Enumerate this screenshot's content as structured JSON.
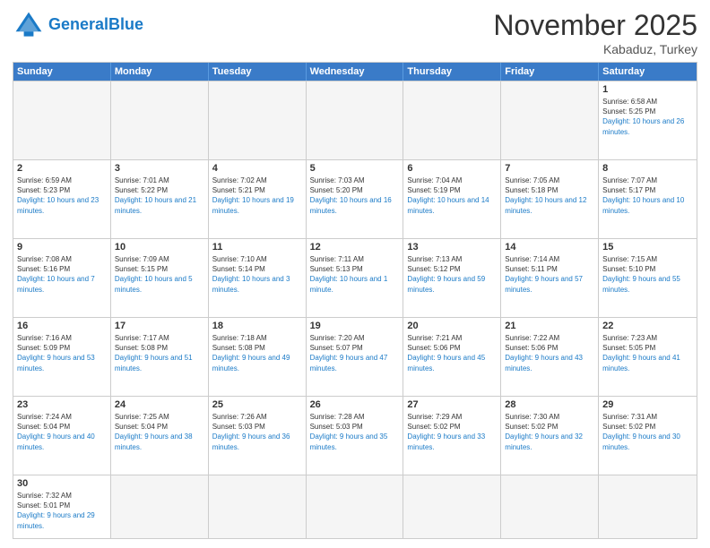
{
  "header": {
    "logo_general": "General",
    "logo_blue": "Blue",
    "month": "November 2025",
    "location": "Kabaduz, Turkey"
  },
  "days_of_week": [
    "Sunday",
    "Monday",
    "Tuesday",
    "Wednesday",
    "Thursday",
    "Friday",
    "Saturday"
  ],
  "weeks": [
    [
      {
        "day": "",
        "sunrise": "",
        "sunset": "",
        "daylight": ""
      },
      {
        "day": "",
        "sunrise": "",
        "sunset": "",
        "daylight": ""
      },
      {
        "day": "",
        "sunrise": "",
        "sunset": "",
        "daylight": ""
      },
      {
        "day": "",
        "sunrise": "",
        "sunset": "",
        "daylight": ""
      },
      {
        "day": "",
        "sunrise": "",
        "sunset": "",
        "daylight": ""
      },
      {
        "day": "",
        "sunrise": "",
        "sunset": "",
        "daylight": ""
      },
      {
        "day": "1",
        "sunrise": "Sunrise: 6:58 AM",
        "sunset": "Sunset: 5:25 PM",
        "daylight": "Daylight: 10 hours and 26 minutes."
      }
    ],
    [
      {
        "day": "2",
        "sunrise": "Sunrise: 6:59 AM",
        "sunset": "Sunset: 5:23 PM",
        "daylight": "Daylight: 10 hours and 23 minutes."
      },
      {
        "day": "3",
        "sunrise": "Sunrise: 7:01 AM",
        "sunset": "Sunset: 5:22 PM",
        "daylight": "Daylight: 10 hours and 21 minutes."
      },
      {
        "day": "4",
        "sunrise": "Sunrise: 7:02 AM",
        "sunset": "Sunset: 5:21 PM",
        "daylight": "Daylight: 10 hours and 19 minutes."
      },
      {
        "day": "5",
        "sunrise": "Sunrise: 7:03 AM",
        "sunset": "Sunset: 5:20 PM",
        "daylight": "Daylight: 10 hours and 16 minutes."
      },
      {
        "day": "6",
        "sunrise": "Sunrise: 7:04 AM",
        "sunset": "Sunset: 5:19 PM",
        "daylight": "Daylight: 10 hours and 14 minutes."
      },
      {
        "day": "7",
        "sunrise": "Sunrise: 7:05 AM",
        "sunset": "Sunset: 5:18 PM",
        "daylight": "Daylight: 10 hours and 12 minutes."
      },
      {
        "day": "8",
        "sunrise": "Sunrise: 7:07 AM",
        "sunset": "Sunset: 5:17 PM",
        "daylight": "Daylight: 10 hours and 10 minutes."
      }
    ],
    [
      {
        "day": "9",
        "sunrise": "Sunrise: 7:08 AM",
        "sunset": "Sunset: 5:16 PM",
        "daylight": "Daylight: 10 hours and 7 minutes."
      },
      {
        "day": "10",
        "sunrise": "Sunrise: 7:09 AM",
        "sunset": "Sunset: 5:15 PM",
        "daylight": "Daylight: 10 hours and 5 minutes."
      },
      {
        "day": "11",
        "sunrise": "Sunrise: 7:10 AM",
        "sunset": "Sunset: 5:14 PM",
        "daylight": "Daylight: 10 hours and 3 minutes."
      },
      {
        "day": "12",
        "sunrise": "Sunrise: 7:11 AM",
        "sunset": "Sunset: 5:13 PM",
        "daylight": "Daylight: 10 hours and 1 minute."
      },
      {
        "day": "13",
        "sunrise": "Sunrise: 7:13 AM",
        "sunset": "Sunset: 5:12 PM",
        "daylight": "Daylight: 9 hours and 59 minutes."
      },
      {
        "day": "14",
        "sunrise": "Sunrise: 7:14 AM",
        "sunset": "Sunset: 5:11 PM",
        "daylight": "Daylight: 9 hours and 57 minutes."
      },
      {
        "day": "15",
        "sunrise": "Sunrise: 7:15 AM",
        "sunset": "Sunset: 5:10 PM",
        "daylight": "Daylight: 9 hours and 55 minutes."
      }
    ],
    [
      {
        "day": "16",
        "sunrise": "Sunrise: 7:16 AM",
        "sunset": "Sunset: 5:09 PM",
        "daylight": "Daylight: 9 hours and 53 minutes."
      },
      {
        "day": "17",
        "sunrise": "Sunrise: 7:17 AM",
        "sunset": "Sunset: 5:08 PM",
        "daylight": "Daylight: 9 hours and 51 minutes."
      },
      {
        "day": "18",
        "sunrise": "Sunrise: 7:18 AM",
        "sunset": "Sunset: 5:08 PM",
        "daylight": "Daylight: 9 hours and 49 minutes."
      },
      {
        "day": "19",
        "sunrise": "Sunrise: 7:20 AM",
        "sunset": "Sunset: 5:07 PM",
        "daylight": "Daylight: 9 hours and 47 minutes."
      },
      {
        "day": "20",
        "sunrise": "Sunrise: 7:21 AM",
        "sunset": "Sunset: 5:06 PM",
        "daylight": "Daylight: 9 hours and 45 minutes."
      },
      {
        "day": "21",
        "sunrise": "Sunrise: 7:22 AM",
        "sunset": "Sunset: 5:06 PM",
        "daylight": "Daylight: 9 hours and 43 minutes."
      },
      {
        "day": "22",
        "sunrise": "Sunrise: 7:23 AM",
        "sunset": "Sunset: 5:05 PM",
        "daylight": "Daylight: 9 hours and 41 minutes."
      }
    ],
    [
      {
        "day": "23",
        "sunrise": "Sunrise: 7:24 AM",
        "sunset": "Sunset: 5:04 PM",
        "daylight": "Daylight: 9 hours and 40 minutes."
      },
      {
        "day": "24",
        "sunrise": "Sunrise: 7:25 AM",
        "sunset": "Sunset: 5:04 PM",
        "daylight": "Daylight: 9 hours and 38 minutes."
      },
      {
        "day": "25",
        "sunrise": "Sunrise: 7:26 AM",
        "sunset": "Sunset: 5:03 PM",
        "daylight": "Daylight: 9 hours and 36 minutes."
      },
      {
        "day": "26",
        "sunrise": "Sunrise: 7:28 AM",
        "sunset": "Sunset: 5:03 PM",
        "daylight": "Daylight: 9 hours and 35 minutes."
      },
      {
        "day": "27",
        "sunrise": "Sunrise: 7:29 AM",
        "sunset": "Sunset: 5:02 PM",
        "daylight": "Daylight: 9 hours and 33 minutes."
      },
      {
        "day": "28",
        "sunrise": "Sunrise: 7:30 AM",
        "sunset": "Sunset: 5:02 PM",
        "daylight": "Daylight: 9 hours and 32 minutes."
      },
      {
        "day": "29",
        "sunrise": "Sunrise: 7:31 AM",
        "sunset": "Sunset: 5:02 PM",
        "daylight": "Daylight: 9 hours and 30 minutes."
      }
    ],
    [
      {
        "day": "30",
        "sunrise": "Sunrise: 7:32 AM",
        "sunset": "Sunset: 5:01 PM",
        "daylight": "Daylight: 9 hours and 29 minutes."
      },
      {
        "day": "",
        "sunrise": "",
        "sunset": "",
        "daylight": ""
      },
      {
        "day": "",
        "sunrise": "",
        "sunset": "",
        "daylight": ""
      },
      {
        "day": "",
        "sunrise": "",
        "sunset": "",
        "daylight": ""
      },
      {
        "day": "",
        "sunrise": "",
        "sunset": "",
        "daylight": ""
      },
      {
        "day": "",
        "sunrise": "",
        "sunset": "",
        "daylight": ""
      },
      {
        "day": "",
        "sunrise": "",
        "sunset": "",
        "daylight": ""
      }
    ]
  ]
}
